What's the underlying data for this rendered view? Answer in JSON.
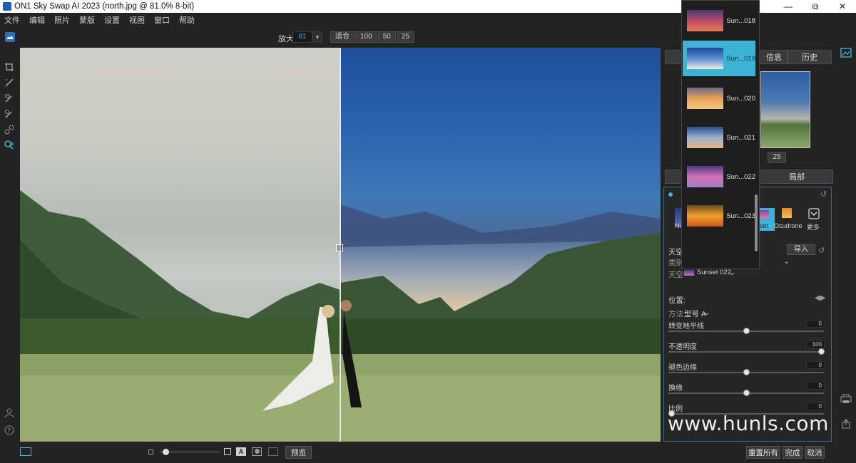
{
  "window": {
    "title": "ON1 Sky Swap AI 2023 (north.jpg @ 81.0% 8-bit)",
    "minimize": "—",
    "maximize": "⧉",
    "close": "✕"
  },
  "menu": [
    "文件",
    "编辑",
    "照片",
    "蒙版",
    "设置",
    "视图",
    "窗口",
    "帮助"
  ],
  "zoom": {
    "label": "放大",
    "value": "81",
    "presets": [
      "适合",
      "100",
      "50",
      "25"
    ]
  },
  "sky_list": [
    {
      "name": "Sun...018",
      "selected": false
    },
    {
      "name": "Sun...019",
      "selected": true
    },
    {
      "name": "Sun...020",
      "selected": false
    },
    {
      "name": "Sun...021",
      "selected": false
    },
    {
      "name": "Sun...022",
      "selected": false
    },
    {
      "name": "Sun...023",
      "selected": false
    }
  ],
  "right_panel": {
    "tabs": [
      "信息",
      "历史"
    ],
    "nav_zoom": "25",
    "sub_tabs": [
      "局部"
    ],
    "presets": [
      {
        "label": "Ni",
        "color": "#3a4a8a"
      },
      {
        "label": "nset",
        "color": "#c76fb0"
      },
      {
        "label": "Ocudrone",
        "color": "#e8872a"
      },
      {
        "label": "更多",
        "color": "#ffffff"
      }
    ],
    "sky_section": {
      "title": "天空",
      "import": "导入",
      "category_label": "类别",
      "sky_label": "天空",
      "sky_value": "Sunset 022"
    },
    "position": {
      "title": "位置:",
      "method_label": "方法",
      "method_value": "型号 A"
    },
    "sliders": [
      {
        "label": "转变地平线",
        "value": "0",
        "level": 0.5
      },
      {
        "label": "不透明度",
        "value": "100",
        "level": 1.0
      },
      {
        "label": "褪色边缘",
        "value": "0",
        "level": 0.5
      },
      {
        "label": "换缘",
        "value": "0",
        "level": 0.5
      },
      {
        "label": "比例",
        "value": "0",
        "level": 0.0
      }
    ]
  },
  "bottom": {
    "preview": "预览",
    "reset_all": "重置所有",
    "done": "完成",
    "cancel": "取消",
    "slider_level": 0.05
  },
  "watermark": "www.hunls.com",
  "colors": {
    "accent": "#3db4d6",
    "panel_bg": "#232323",
    "canvas_before": "#c8c9c3",
    "canvas_after": "#2b63ae"
  }
}
